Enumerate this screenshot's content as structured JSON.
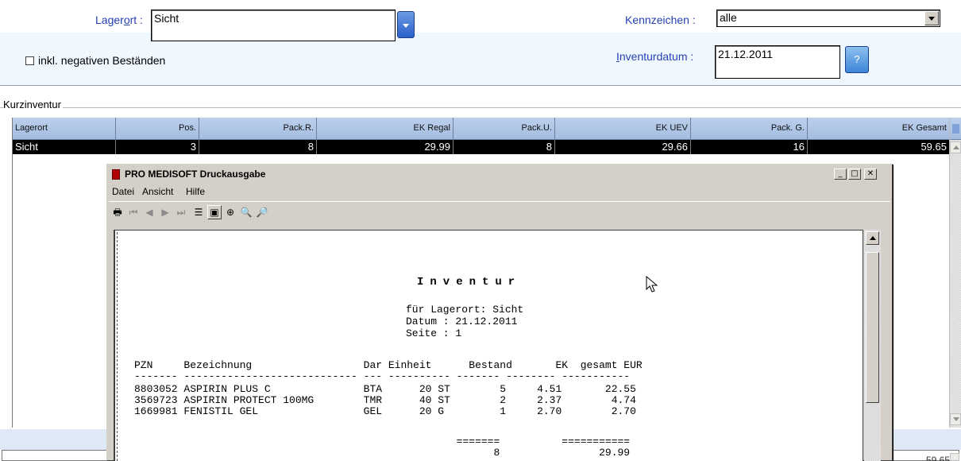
{
  "filters": {
    "lagerort_label_pre": "Lager",
    "lagerort_label_ul": "o",
    "lagerort_label_post": "rt :",
    "lagerort_value": "Sicht",
    "kennzeichen_label": "Kennzeichen :",
    "kennzeichen_value": "alle",
    "negative_checkbox_label": "inkl. negativen Beständen",
    "inventurdatum_label_ul": "I",
    "inventurdatum_label_post": "nventurdatum :",
    "inventurdatum_value": "21.12.2011",
    "help_button": "?"
  },
  "group": {
    "title": "Kurzinventur"
  },
  "grid": {
    "columns": [
      "Lagerort",
      "Pos.",
      "Pack.R.",
      "EK Regal",
      "Pack.U.",
      "EK UEV",
      "Pack. G.",
      "EK Gesamt"
    ],
    "rows": [
      [
        "Sicht",
        "3",
        "8",
        "29.99",
        "8",
        "29.66",
        "16",
        "59.65"
      ]
    ],
    "total_value": "59.65"
  },
  "print_window": {
    "title": "PRO MEDISOFT Druckausgabe",
    "menu": [
      "Datei",
      "Ansicht",
      "Hilfe"
    ],
    "window_buttons": {
      "minimize": "_",
      "maximize": "□",
      "close": "✕"
    }
  },
  "report": {
    "title": "Inventur",
    "lagerort_line": "für Lagerort: Sicht",
    "datum_line": "Datum : 21.12.2011",
    "seite_line": "Seite : 1",
    "header_line": "PZN     Bezeichnung                  Dar Einheit      Bestand       EK  gesamt EUR",
    "separator_line": "------- ---------------------------- --- ---------- ------- -------- -----------",
    "items": [
      "8803052 ASPIRIN PLUS C               BTA      20 ST        5     4.51       22.55",
      "3569723 ASPIRIN PROTECT 100MG        TMR      40 ST        2     2.37        4.74",
      "1669981 FENISTIL GEL                 GEL      20 G         1     2.70        2.70"
    ],
    "sum_separator_line": "                                                    =======          ===========",
    "sum_line": "                                                          8                29.99"
  }
}
